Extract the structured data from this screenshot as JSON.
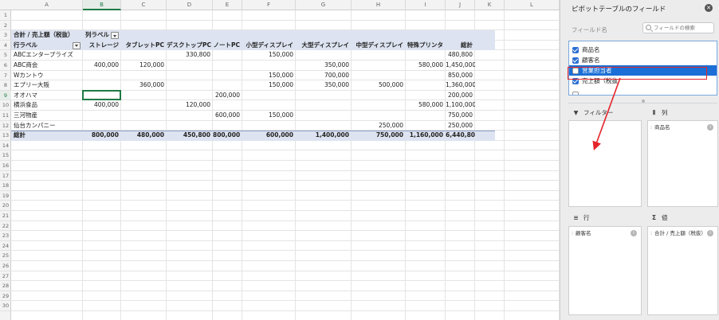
{
  "columns": [
    "A",
    "B",
    "C",
    "D",
    "E",
    "F",
    "G",
    "H",
    "I",
    "J",
    "K",
    "L"
  ],
  "selected_column": "B",
  "rows": [
    "1",
    "2",
    "3",
    "4",
    "5",
    "6",
    "7",
    "8",
    "9",
    "10",
    "11",
    "12",
    "13",
    "14",
    "15",
    "16",
    "17",
    "18",
    "19",
    "20",
    "21",
    "22",
    "23",
    "24",
    "25",
    "26",
    "27",
    "28",
    "29",
    "30"
  ],
  "selected_row": "9",
  "pivot": {
    "value_title": "合計 / 売上額（税抜）",
    "col_label_header": "列ラベル",
    "row_label_header": "行ラベル",
    "column_headers": [
      "ストレージ",
      "タブレットPC",
      "デスクトップPC",
      "ノートPC",
      "小型ディスプレイ",
      "大型ディスプレイ",
      "中型ディスプレイ",
      "特殊プリンタ",
      "総計"
    ],
    "rows": [
      {
        "label": "ABCエンタープライズ",
        "cells": [
          "",
          "",
          "330,800",
          "",
          "150,000",
          "",
          "",
          "",
          "480,800"
        ]
      },
      {
        "label": "ABC商会",
        "cells": [
          "400,000",
          "120,000",
          "",
          "",
          "",
          "350,000",
          "",
          "580,000",
          "1,450,000"
        ]
      },
      {
        "label": "Wカントウ",
        "cells": [
          "",
          "",
          "",
          "",
          "150,000",
          "700,000",
          "",
          "",
          "850,000"
        ]
      },
      {
        "label": "エプリー大阪",
        "cells": [
          "",
          "360,000",
          "",
          "",
          "150,000",
          "350,000",
          "500,000",
          "",
          "1,360,000"
        ]
      },
      {
        "label": "オオハマ",
        "cells": [
          "",
          "",
          "",
          "200,000",
          "",
          "",
          "",
          "",
          "200,000"
        ]
      },
      {
        "label": "横浜食品",
        "cells": [
          "400,000",
          "",
          "120,000",
          "",
          "",
          "",
          "",
          "580,000",
          "1,100,000"
        ]
      },
      {
        "label": "三河物産",
        "cells": [
          "",
          "",
          "",
          "600,000",
          "150,000",
          "",
          "",
          "",
          "750,000"
        ]
      },
      {
        "label": "仙台カンパニー",
        "cells": [
          "",
          "",
          "",
          "",
          "",
          "",
          "250,000",
          "",
          "250,000"
        ]
      }
    ],
    "total": {
      "label": "総計",
      "cells": [
        "800,000",
        "480,000",
        "450,800",
        "800,000",
        "600,000",
        "1,400,000",
        "750,000",
        "1,160,000",
        "6,440,800"
      ]
    }
  },
  "panel": {
    "title": "ピボットテーブルのフィールド",
    "close_icon": "close-icon",
    "field_name_label": "フィールド名",
    "search_placeholder": "フィールドの検索",
    "fields": [
      {
        "name": "商品名",
        "checked": true
      },
      {
        "name": "顧客名",
        "checked": true
      },
      {
        "name": "営業担当者",
        "checked": false,
        "highlighted": true
      },
      {
        "name": "売上額（税抜",
        "checked": true
      }
    ],
    "areas": {
      "filter": {
        "label": "フィルター",
        "icon": "filter-icon",
        "items": []
      },
      "columns": {
        "label": "列",
        "icon": "columns-icon",
        "items": [
          "商品名"
        ]
      },
      "rows": {
        "label": "行",
        "icon": "rows-icon",
        "items": [
          "顧客名"
        ]
      },
      "values": {
        "label": "値",
        "icon": "sigma-icon",
        "items": [
          "合計 / 売上額（税抜）"
        ]
      }
    }
  },
  "colors": {
    "pivot_band": "#dde3f0",
    "selection_green": "#1f7a44",
    "highlight_blue": "#1b6fd6",
    "annotation_red": "#e3242b"
  }
}
